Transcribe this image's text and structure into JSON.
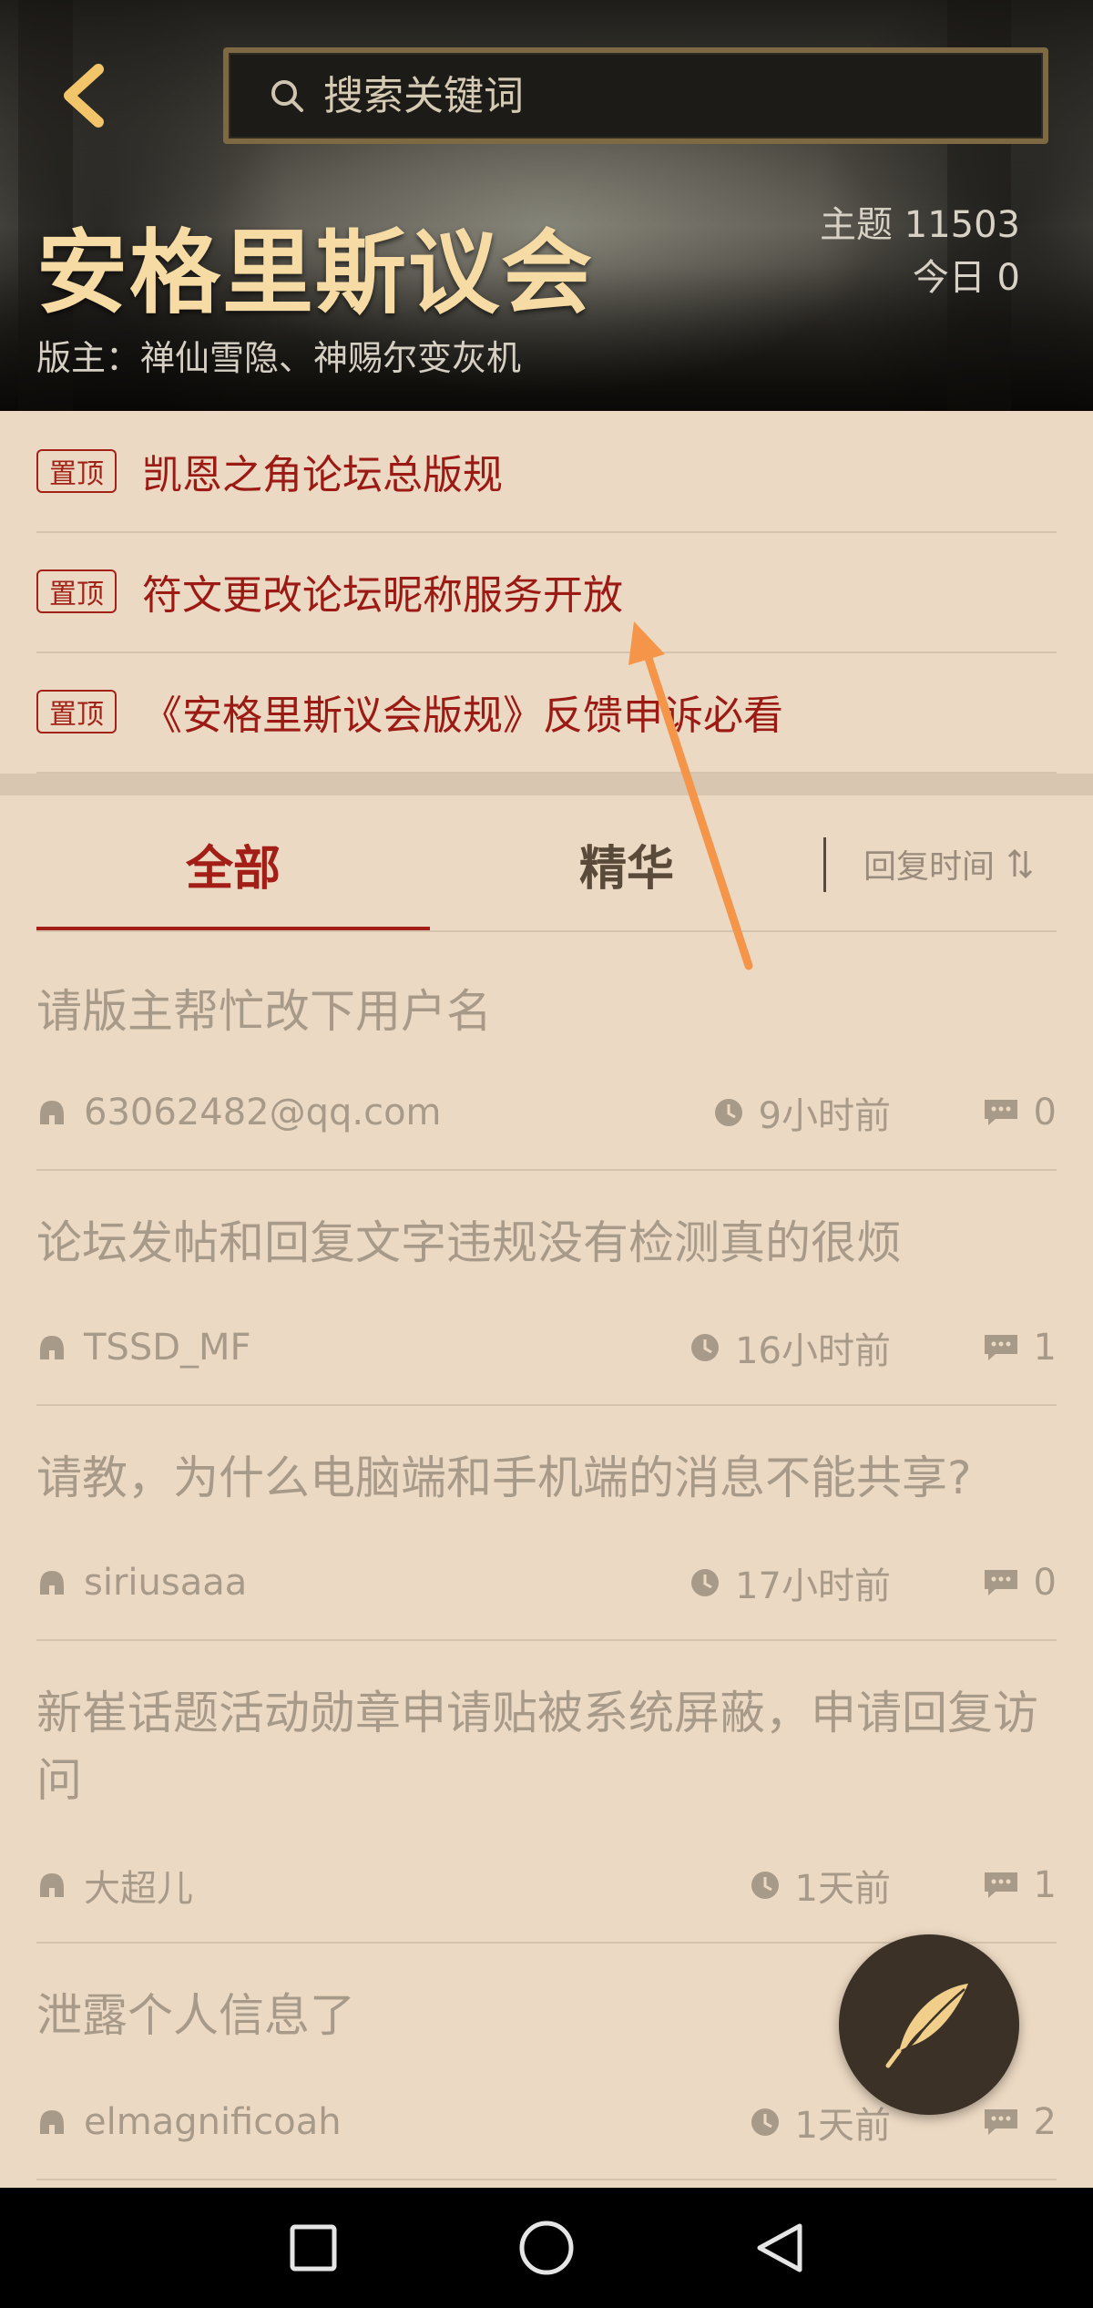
{
  "header": {
    "back_icon": "chevron-left-icon",
    "search_placeholder": "搜索关键词",
    "forum_title": "安格里斯议会",
    "moderators": "版主：禅仙雪隐、神赐尔变灰机",
    "topics": "主题 11503",
    "today": "今日 0"
  },
  "pinned": [
    {
      "badge": "置顶",
      "title": "凯恩之角论坛总版规"
    },
    {
      "badge": "置顶",
      "title": "符文更改论坛昵称服务开放"
    },
    {
      "badge": "置顶",
      "title": "《安格里斯议会版规》反馈申诉必看"
    }
  ],
  "tabs": {
    "all": "全部",
    "elite": "精华",
    "sort": "回复时间"
  },
  "threads": [
    {
      "title": "请版主帮忙改下用户名",
      "author": "63062482@qq.com",
      "time": "9小时前",
      "replies": "0"
    },
    {
      "title": "论坛发帖和回复文字违规没有检测真的很烦",
      "author": "TSSD_MF",
      "time": "16小时前",
      "replies": "1"
    },
    {
      "title": "请教，为什么电脑端和手机端的消息不能共享?",
      "author": "siriusaaa",
      "time": "17小时前",
      "replies": "0"
    },
    {
      "title": "新崔话题活动勋章申请贴被系统屏蔽，申请回复访问",
      "author": "大超儿",
      "time": "1天前",
      "replies": "1"
    },
    {
      "title": "泄露个人信息了",
      "author": "elmagnificoah",
      "time": "1天前",
      "replies": "2"
    }
  ],
  "fab_icon": "quill-icon",
  "colors": {
    "accent": "#a21e16",
    "title_gold": "#f6dca4",
    "background": "#ecd9c3",
    "annotation_arrow": "#f4954a"
  }
}
